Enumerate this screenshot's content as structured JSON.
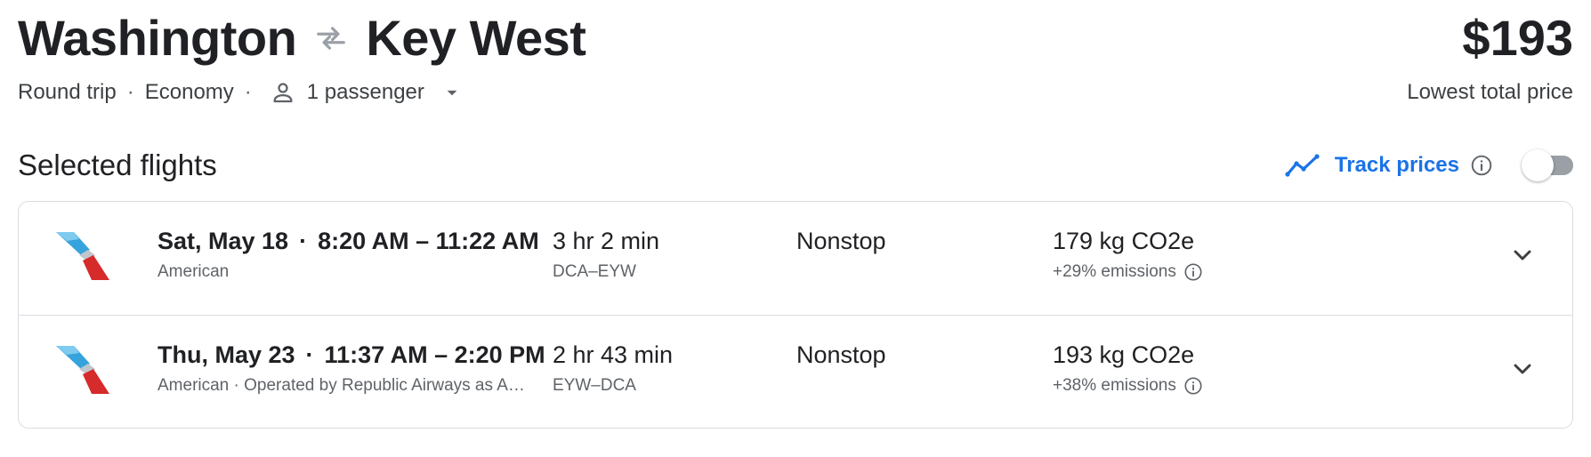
{
  "header": {
    "origin": "Washington",
    "destination": "Key West",
    "price": "$193",
    "price_caption": "Lowest total price",
    "trip_type": "Round trip",
    "cabin": "Economy",
    "passengers": "1 passenger",
    "icons": {
      "swap": "swap-arrows-icon",
      "person": "person-icon",
      "caret": "caret-down-icon"
    }
  },
  "section": {
    "title": "Selected flights",
    "track_label": "Track prices",
    "track_enabled": false,
    "icons": {
      "trend": "trend-line-icon",
      "info": "info-icon"
    }
  },
  "flights": [
    {
      "date": "Sat, May 18",
      "times": "8:20 AM – 11:22 AM",
      "carrier": "American",
      "duration": "3 hr 2 min",
      "airports": "DCA–EYW",
      "stops": "Nonstop",
      "co2": "179 kg CO2e",
      "emissions": "+29% emissions"
    },
    {
      "date": "Thu, May 23",
      "times": "11:37 AM – 2:20 PM",
      "carrier": "American · Operated by Republic Airways as American Eagle",
      "duration": "2 hr 43 min",
      "airports": "EYW–DCA",
      "stops": "Nonstop",
      "co2": "193 kg CO2e",
      "emissions": "+38% emissions"
    }
  ],
  "colors": {
    "accent": "#1a73e8",
    "text": "#202124",
    "secondary": "#5f6368",
    "border": "#dadce0",
    "logo_blue": "#36a3dc",
    "logo_red": "#d62b2b"
  }
}
